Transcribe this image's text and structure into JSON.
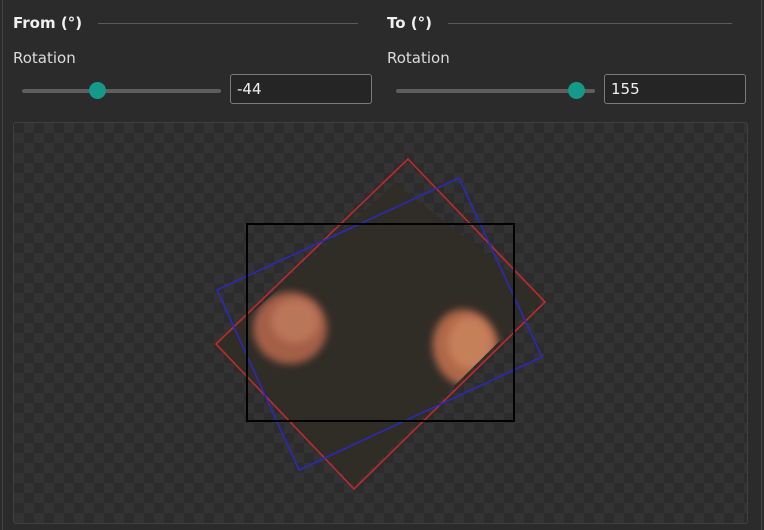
{
  "from": {
    "title": "From (°)",
    "rotation_label": "Rotation",
    "rotation_value": "-44",
    "slider_level": 0.41
  },
  "to": {
    "title": "To (°)",
    "rotation_label": "Rotation",
    "rotation_value": "155",
    "slider_level": 0.91
  },
  "colors": {
    "accent": "#139a8a",
    "from_outline": "#c02a2a",
    "to_outline": "#2a2ab8",
    "view_outline": "#000000"
  }
}
